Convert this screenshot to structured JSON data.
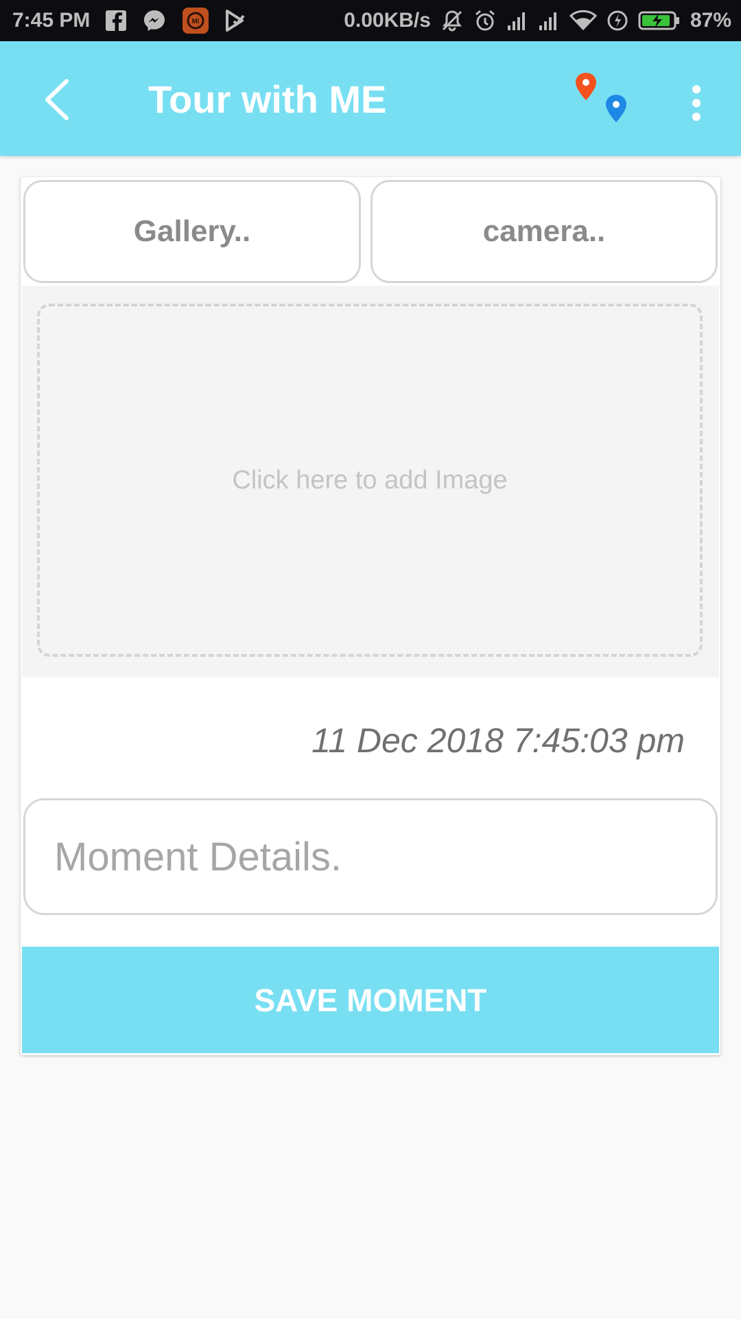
{
  "status_bar": {
    "time": "7:45 PM",
    "network_speed": "0.00KB/s",
    "battery": "87%",
    "icons": [
      "facebook-icon",
      "messenger-icon",
      "mi-app-icon",
      "play-store-icon",
      "mute-icon",
      "alarm-icon",
      "signal-icon",
      "signal-icon",
      "wifi-icon",
      "power-saver-icon",
      "battery-charging-icon"
    ]
  },
  "app_bar": {
    "title": "Tour with ME",
    "back_icon": "back-arrow-icon",
    "map_icon": "map-pins-icon",
    "more_icon": "more-vert-icon",
    "colors": {
      "bar": "#78dff2",
      "pin_red": "#f4511e",
      "pin_blue": "#1e88e5"
    }
  },
  "form": {
    "gallery_label": "Gallery..",
    "camera_label": "camera..",
    "image_placeholder": "Click here to add Image",
    "date": "11 Dec 2018 7:45:03 pm",
    "details_placeholder": "Moment Details.",
    "save_label": "SAVE MOMENT"
  }
}
